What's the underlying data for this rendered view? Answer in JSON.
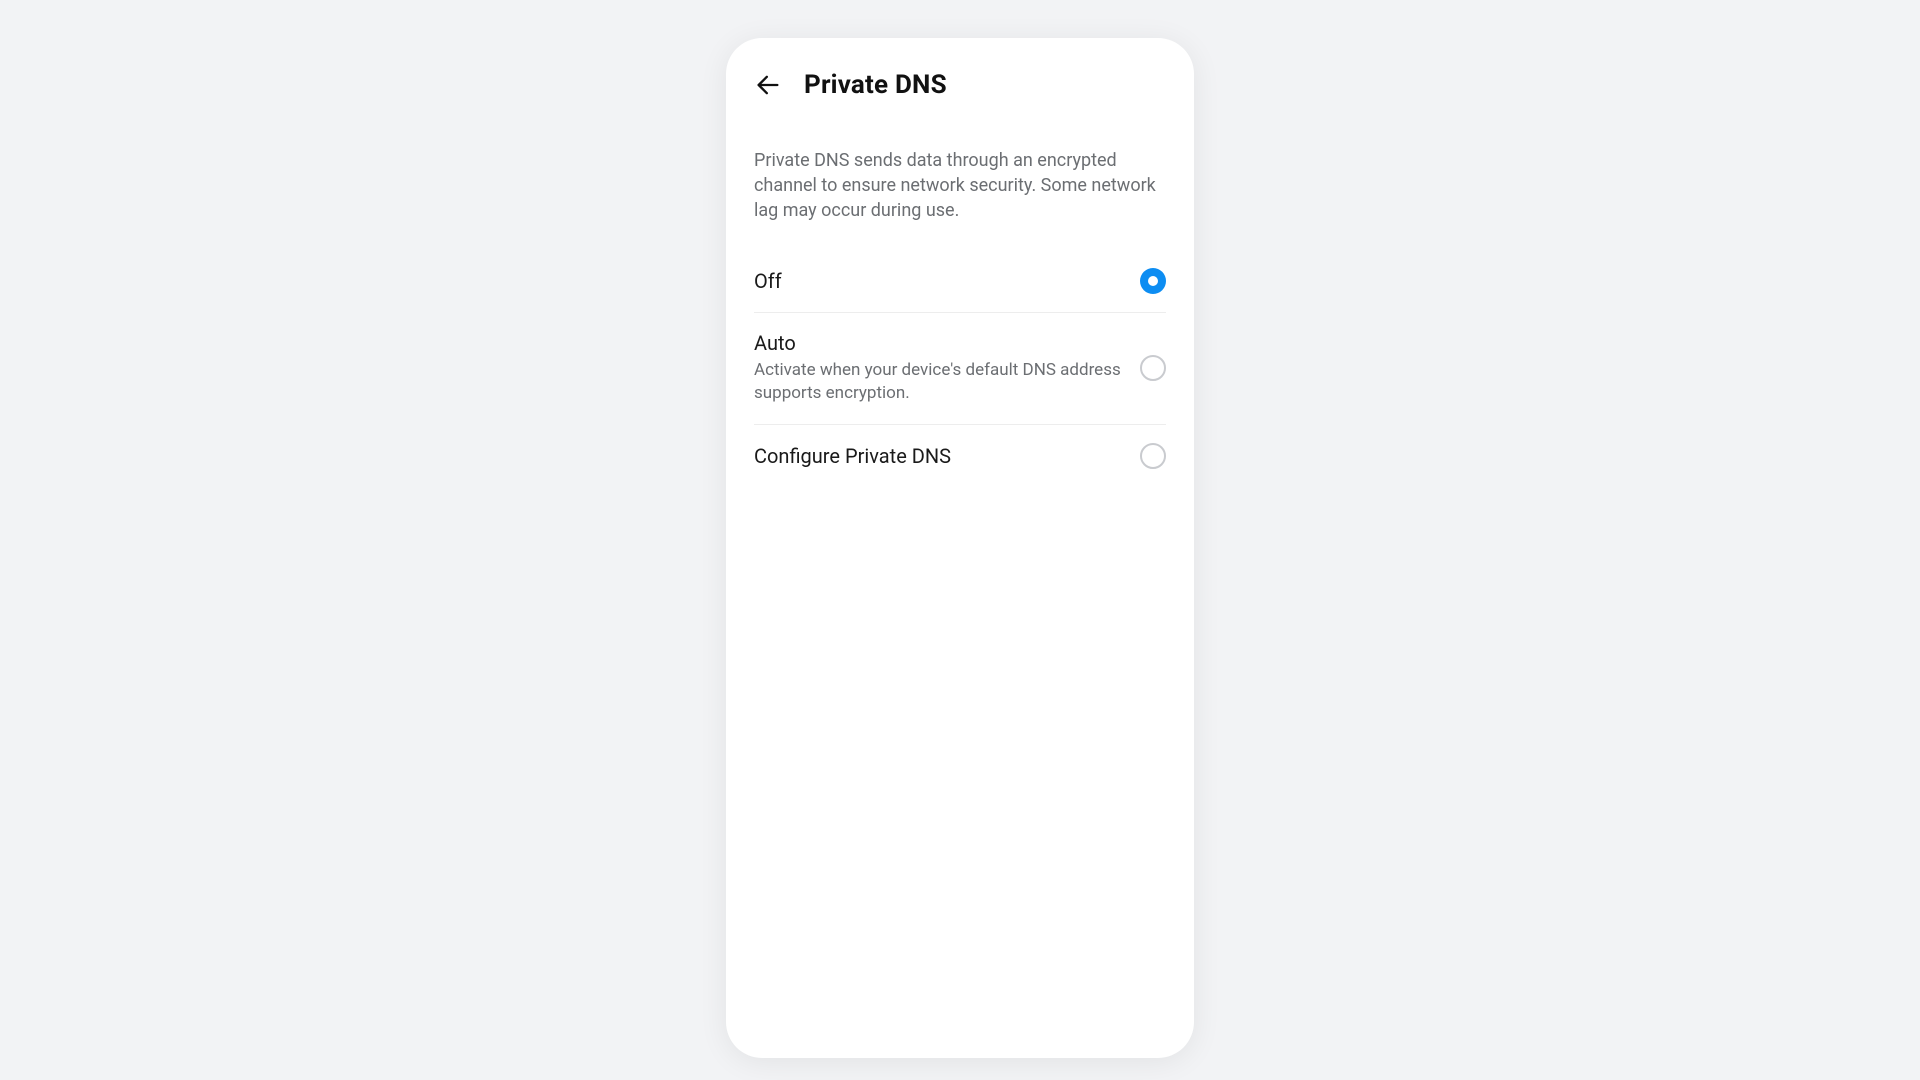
{
  "header": {
    "title": "Private DNS"
  },
  "description": "Private DNS sends data through an encrypted channel to ensure network security. Some network lag may occur during use.",
  "options": [
    {
      "title": "Off",
      "subtitle": "",
      "selected": true
    },
    {
      "title": "Auto",
      "subtitle": "Activate when your device's default DNS address supports encryption.",
      "selected": false
    },
    {
      "title": "Configure Private DNS",
      "subtitle": "",
      "selected": false
    }
  ]
}
